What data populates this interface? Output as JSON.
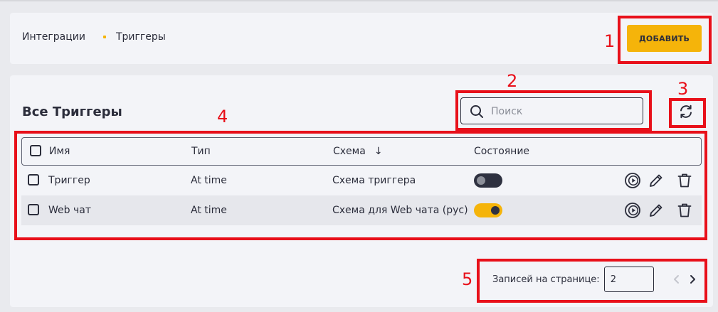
{
  "breadcrumb": {
    "root": "Интеграции",
    "current": "Триггеры"
  },
  "header": {
    "add_label": "ДОБАВИТЬ"
  },
  "main": {
    "title": "Все Триггеры",
    "search_placeholder": "Поиск",
    "columns": {
      "name": "Имя",
      "type": "Тип",
      "scheme": "Схема",
      "sort_arrow": "↓",
      "state": "Состояние"
    },
    "rows": [
      {
        "name": "Триггер",
        "type": "At time",
        "scheme": "Схема триггера",
        "enabled": false
      },
      {
        "name": "Web чат",
        "type": "At time",
        "scheme": "Схема для Web чата (рус)",
        "enabled": true
      }
    ]
  },
  "pagination": {
    "label": "Записей на странице:",
    "value": "2"
  },
  "annotations": [
    "1",
    "2",
    "3",
    "4",
    "5"
  ],
  "colors": {
    "accent": "#f5b40a",
    "annotation": "#e8101a",
    "text": "#2b2d3b"
  }
}
